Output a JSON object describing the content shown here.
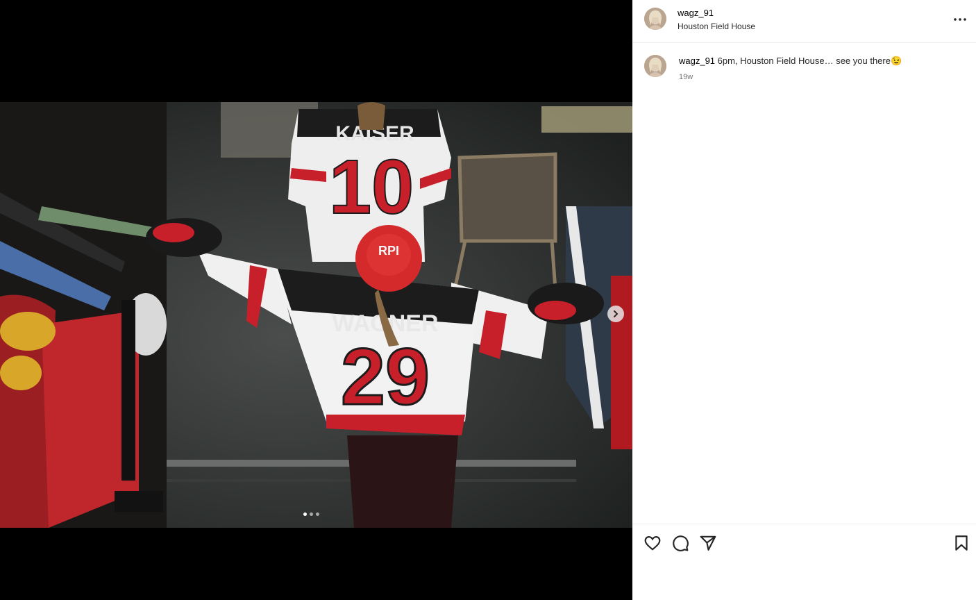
{
  "post": {
    "username": "wagz_91",
    "location": "Houston Field House"
  },
  "caption": {
    "username": "wagz_91",
    "text": "6pm, Houston Field House… see you there😉",
    "time": "19w"
  },
  "photo": {
    "jersey_back_name": "WAGNER",
    "jersey_back_number": "29",
    "jersey_front_name": "KAISER",
    "jersey_front_number": "10",
    "helmet_text": "RPI"
  },
  "carousel": {
    "total": 3,
    "current": 1
  },
  "icons": {
    "more": "more-horizontal-icon",
    "next": "chevron-right-icon",
    "like": "heart-icon",
    "comment": "comment-icon",
    "share": "send-icon",
    "save": "bookmark-icon"
  },
  "colors": {
    "red": "#c8202a",
    "white": "#f0f0f0",
    "dark": "#1b1b1b"
  }
}
